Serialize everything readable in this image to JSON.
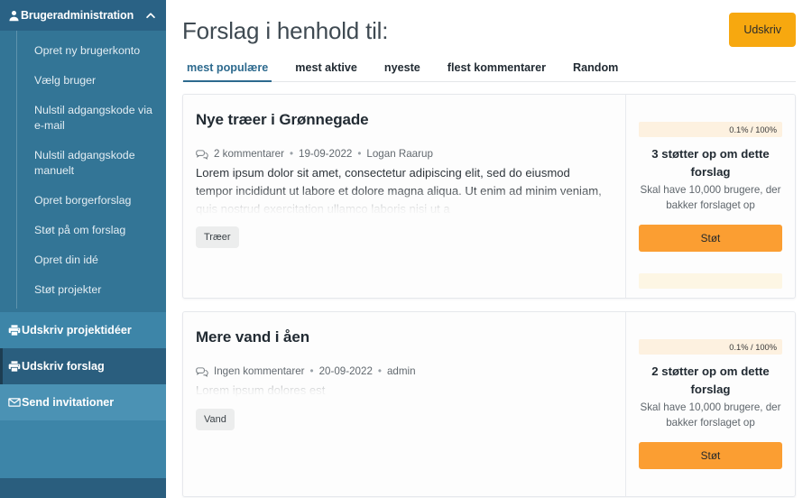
{
  "sidebar": {
    "header": {
      "label": "Brugeradministration",
      "icon": "person-icon",
      "toggle_icon": "chevron-up-icon"
    },
    "sub_items": [
      {
        "label": "Opret ny brugerkonto"
      },
      {
        "label": "Vælg bruger"
      },
      {
        "label": "Nulstil adgangskode via e-mail"
      },
      {
        "label": "Nulstil adgangskode manuelt"
      },
      {
        "label": "Opret borgerforslag"
      },
      {
        "label": "Støt på om forslag"
      },
      {
        "label": "Opret din idé"
      },
      {
        "label": "Støt projekter"
      }
    ],
    "main_items": [
      {
        "label": "Udskriv projektidéer",
        "icon": "printer-icon",
        "state": "default"
      },
      {
        "label": "Udskriv forslag",
        "icon": "printer-icon",
        "state": "active"
      },
      {
        "label": "Send invitationer",
        "icon": "envelope-icon",
        "state": "highlight"
      }
    ],
    "colors": {
      "base": "#3d85a8",
      "header": "#2a6285",
      "submenu": "#337596",
      "active": "#2a5e7e",
      "highlight": "#4b92b4"
    }
  },
  "header": {
    "title": "Forslag i henhold til:",
    "print_button": "Udskriv"
  },
  "tabs": [
    {
      "label": "mest populære",
      "active": true
    },
    {
      "label": "mest aktive",
      "active": false
    },
    {
      "label": "nyeste",
      "active": false
    },
    {
      "label": "flest kommentarer",
      "active": false
    },
    {
      "label": "Random",
      "active": false
    }
  ],
  "proposals": [
    {
      "title": "Nye træer i Grønnegade",
      "comments": "2 kommentarer",
      "date": "19-09-2022",
      "author": "Logan Raarup",
      "excerpt": "Lorem ipsum dolor sit amet, consectetur adipiscing elit, sed do eiusmod tempor incididunt ut labore et dolore magna aliqua. Ut enim ad minim veniam, quis nostrud exercitation ullamco laboris nisi ut a",
      "tags": [
        "Træer"
      ],
      "progress_label": "0.1% / 100%",
      "support_count": "3 støtter op om dette forslag",
      "support_note": "Skal have 10,000 brugere, der bakker forslaget op",
      "support_button": "Støt",
      "has_bottom_bar": true
    },
    {
      "title": "Mere vand i åen",
      "comments": "Ingen kommentarer",
      "date": "20-09-2022",
      "author": "admin",
      "excerpt": "Lorem ipsum dolores est",
      "tags": [
        "Vand"
      ],
      "progress_label": "0.1% / 100%",
      "support_count": "2 støtter op om dette forslag",
      "support_note": "Skal have 10,000 brugere, der bakker forslaget op",
      "support_button": "Støt",
      "has_bottom_bar": false
    }
  ],
  "colors": {
    "accent_orange": "#f7a80f",
    "support_orange": "#fb9e32",
    "brand_blue": "#2d6a8e",
    "progress_track": "#fdf1e0"
  }
}
